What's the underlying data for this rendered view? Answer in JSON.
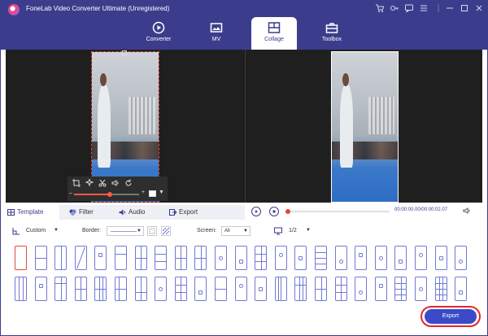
{
  "app": {
    "title": "FoneLab Video Converter Ultimate (Unregistered)",
    "window_controls": [
      "cart-icon",
      "key-icon",
      "chat-icon",
      "menu-icon",
      "minimize-icon",
      "maximize-icon",
      "close-icon"
    ]
  },
  "nav": {
    "tabs": [
      {
        "label": "Converter",
        "icon": "converter-icon",
        "active": false
      },
      {
        "label": "MV",
        "icon": "mv-icon",
        "active": false
      },
      {
        "label": "Collage",
        "icon": "collage-icon",
        "active": true
      },
      {
        "label": "Toolbox",
        "icon": "toolbox-icon",
        "active": false
      }
    ]
  },
  "bottom_tabs": [
    {
      "label": "Template",
      "icon": "template-icon",
      "active": true
    },
    {
      "label": "Filter",
      "icon": "filter-icon",
      "active": false
    },
    {
      "label": "Audio",
      "icon": "audio-icon",
      "active": false
    },
    {
      "label": "Export",
      "icon": "export-icon",
      "active": false
    }
  ],
  "player": {
    "timecode": "00:00:00.00/00:00:02.07",
    "progress": 0.0
  },
  "options": {
    "layout_value": "Custom",
    "border_label": "Border:",
    "screen_label": "Screen:",
    "screen_value": "All",
    "page_value": "1/2"
  },
  "edit_toolbar": {
    "tools": [
      "crop-icon",
      "effect-icon",
      "cut-icon",
      "volume-icon",
      "rotate-icon"
    ],
    "volume_level": 0.55
  },
  "templates": {
    "rows": 2,
    "per_row": 23,
    "selected_index": 0
  },
  "export_button": {
    "label": "Export"
  },
  "colors": {
    "header": "#3b3d8c",
    "accent": "#3b4bc8",
    "template_outline": "#6e7bd6",
    "selection": "#e4473a",
    "highlight_ring": "#e5262b"
  }
}
